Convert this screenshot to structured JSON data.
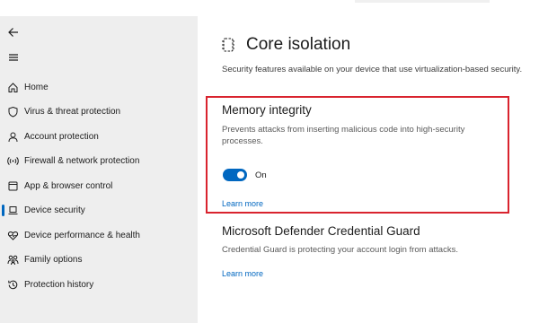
{
  "sidebar": {
    "back_icon": "back-arrow-icon",
    "menu_icon": "hamburger-menu-icon",
    "items": [
      {
        "label": "Home",
        "icon": "home-icon",
        "selected": false
      },
      {
        "label": "Virus & threat protection",
        "icon": "shield-icon",
        "selected": false
      },
      {
        "label": "Account protection",
        "icon": "person-icon",
        "selected": false
      },
      {
        "label": "Firewall & network protection",
        "icon": "wifi-signal-icon",
        "selected": false
      },
      {
        "label": "App & browser control",
        "icon": "app-window-icon",
        "selected": false
      },
      {
        "label": "Device security",
        "icon": "laptop-icon",
        "selected": true
      },
      {
        "label": "Device performance & health",
        "icon": "heart-icon",
        "selected": false
      },
      {
        "label": "Family options",
        "icon": "family-icon",
        "selected": false
      },
      {
        "label": "Protection history",
        "icon": "history-icon",
        "selected": false
      }
    ]
  },
  "main": {
    "page_icon": "chip-icon",
    "title": "Core isolation",
    "description": "Security features available on your device that use virtualization-based security.",
    "memory_integrity": {
      "title": "Memory integrity",
      "description": "Prevents attacks from inserting malicious code into high-security processes.",
      "toggle_state": "On",
      "toggle_on": true,
      "link": "Learn more"
    },
    "credential_guard": {
      "title": "Microsoft Defender Credential Guard",
      "description": "Credential Guard is protecting your account login from attacks.",
      "link": "Learn more"
    }
  },
  "colors": {
    "accent": "#0067c0",
    "highlight_border": "#d9232e",
    "sidebar_bg": "#eeeeee"
  }
}
